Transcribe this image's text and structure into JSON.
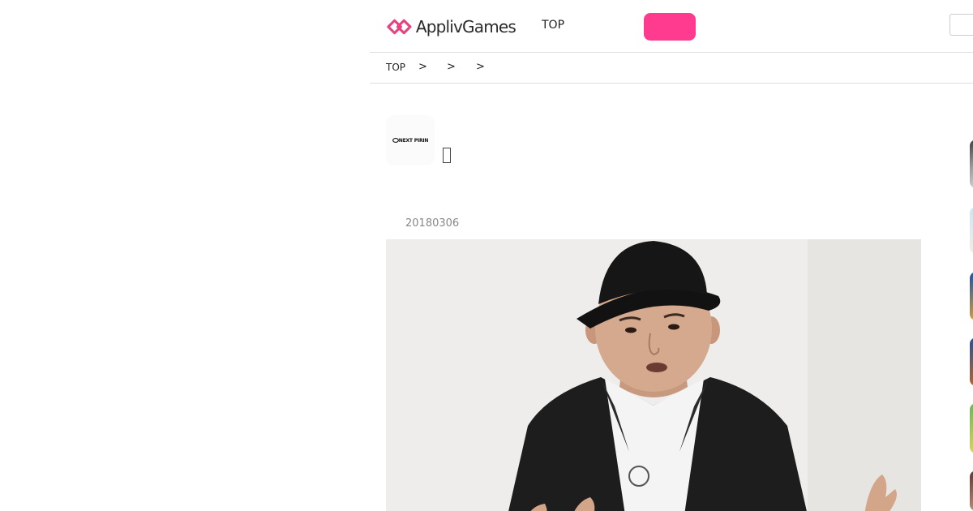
{
  "header": {
    "brand": "ApplivGames",
    "nav_top": "TOP"
  },
  "breadcrumb": {
    "items": [
      "TOP"
    ],
    "separator": ">"
  },
  "article": {
    "date": "20180306"
  },
  "developer": {
    "logo_text": "NEXT PIRIN"
  },
  "colors": {
    "accent_pink": "#ff3b8f",
    "logo_pink": "#e9407f",
    "text_gray": "#888888"
  },
  "icons": [
    "applivgames-logo-icon",
    "missing-glyph-icon"
  ]
}
